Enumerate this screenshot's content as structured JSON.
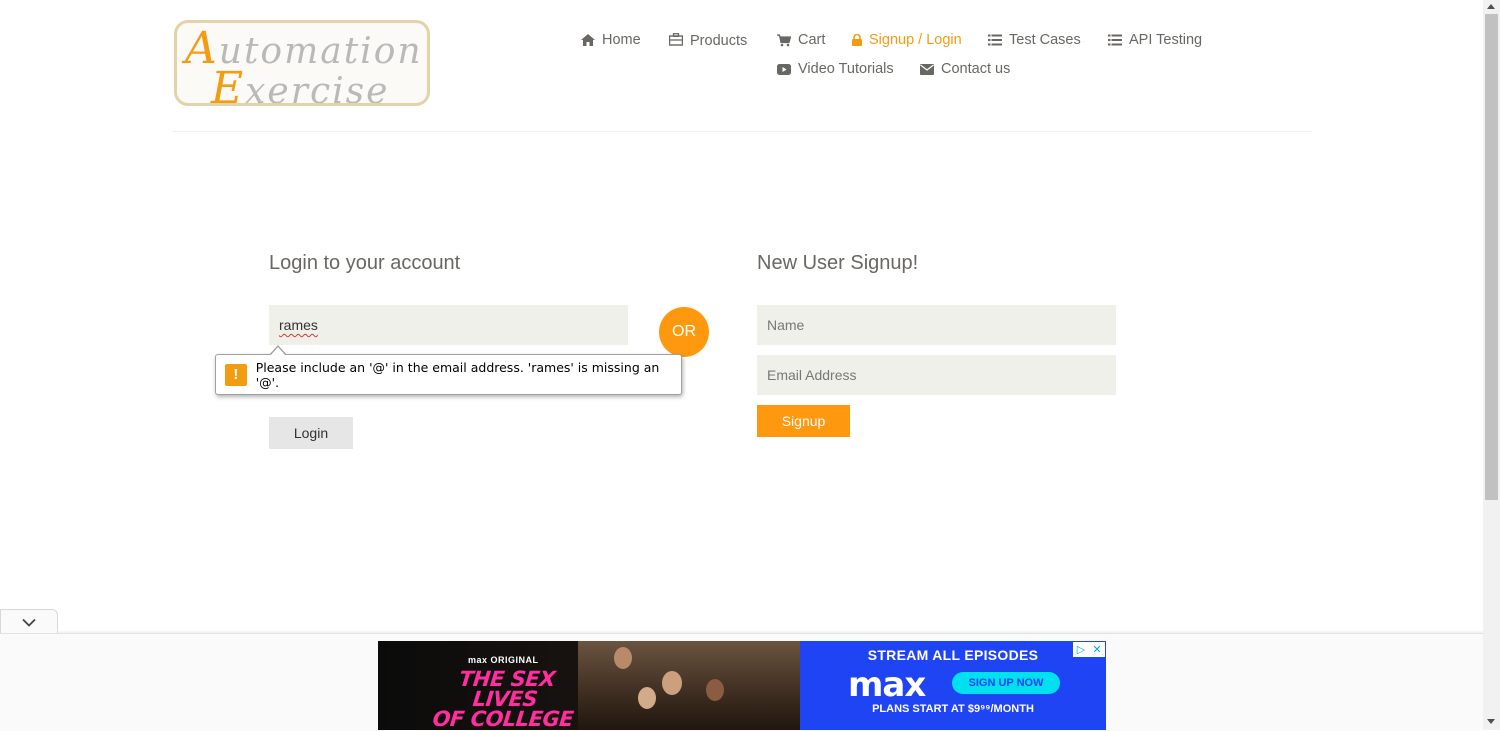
{
  "header": {
    "logo": {
      "line1": "Automation",
      "line2": "Exercise"
    },
    "nav": [
      {
        "id": "home",
        "label": "Home",
        "icon": "home-icon"
      },
      {
        "id": "products",
        "label": "Products",
        "icon": "briefcase-icon"
      },
      {
        "id": "cart",
        "label": "Cart",
        "icon": "cart-icon"
      },
      {
        "id": "signup-login",
        "label": "Signup / Login",
        "icon": "lock-icon",
        "active": true
      },
      {
        "id": "test-cases",
        "label": "Test Cases",
        "icon": "list-icon"
      },
      {
        "id": "api-testing",
        "label": "API Testing",
        "icon": "list-icon"
      },
      {
        "id": "video-tutorials",
        "label": "Video Tutorials",
        "icon": "youtube-play-icon"
      },
      {
        "id": "contact-us",
        "label": "Contact us",
        "icon": "envelope-icon"
      }
    ]
  },
  "login": {
    "title": "Login to your account",
    "email_value": "rames",
    "button_label": "Login"
  },
  "or_label": "OR",
  "signup": {
    "title": "New User Signup!",
    "name_placeholder": "Name",
    "email_placeholder": "Email Address",
    "button_label": "Signup"
  },
  "validation": {
    "message": "Please include an '@' in the email address. 'rames' is missing an '@'.",
    "icon": "warning-icon"
  },
  "ad": {
    "small_brand": "max ORIGINAL",
    "show_line1": "THE SEX LIVES",
    "show_line2": "OF COLLEGE GIRLS",
    "stream_text": "STREAM ALL EPISODES",
    "brand": "max",
    "cta_label": "SIGN UP NOW",
    "plans_text": "PLANS START AT $9⁹⁹/MONTH"
  },
  "colors": {
    "accent": "#fe980f",
    "active_nav": "#f39c12",
    "text": "#696763",
    "input_bg": "#f0f0ea",
    "ad_blue": "#1e44f3"
  }
}
